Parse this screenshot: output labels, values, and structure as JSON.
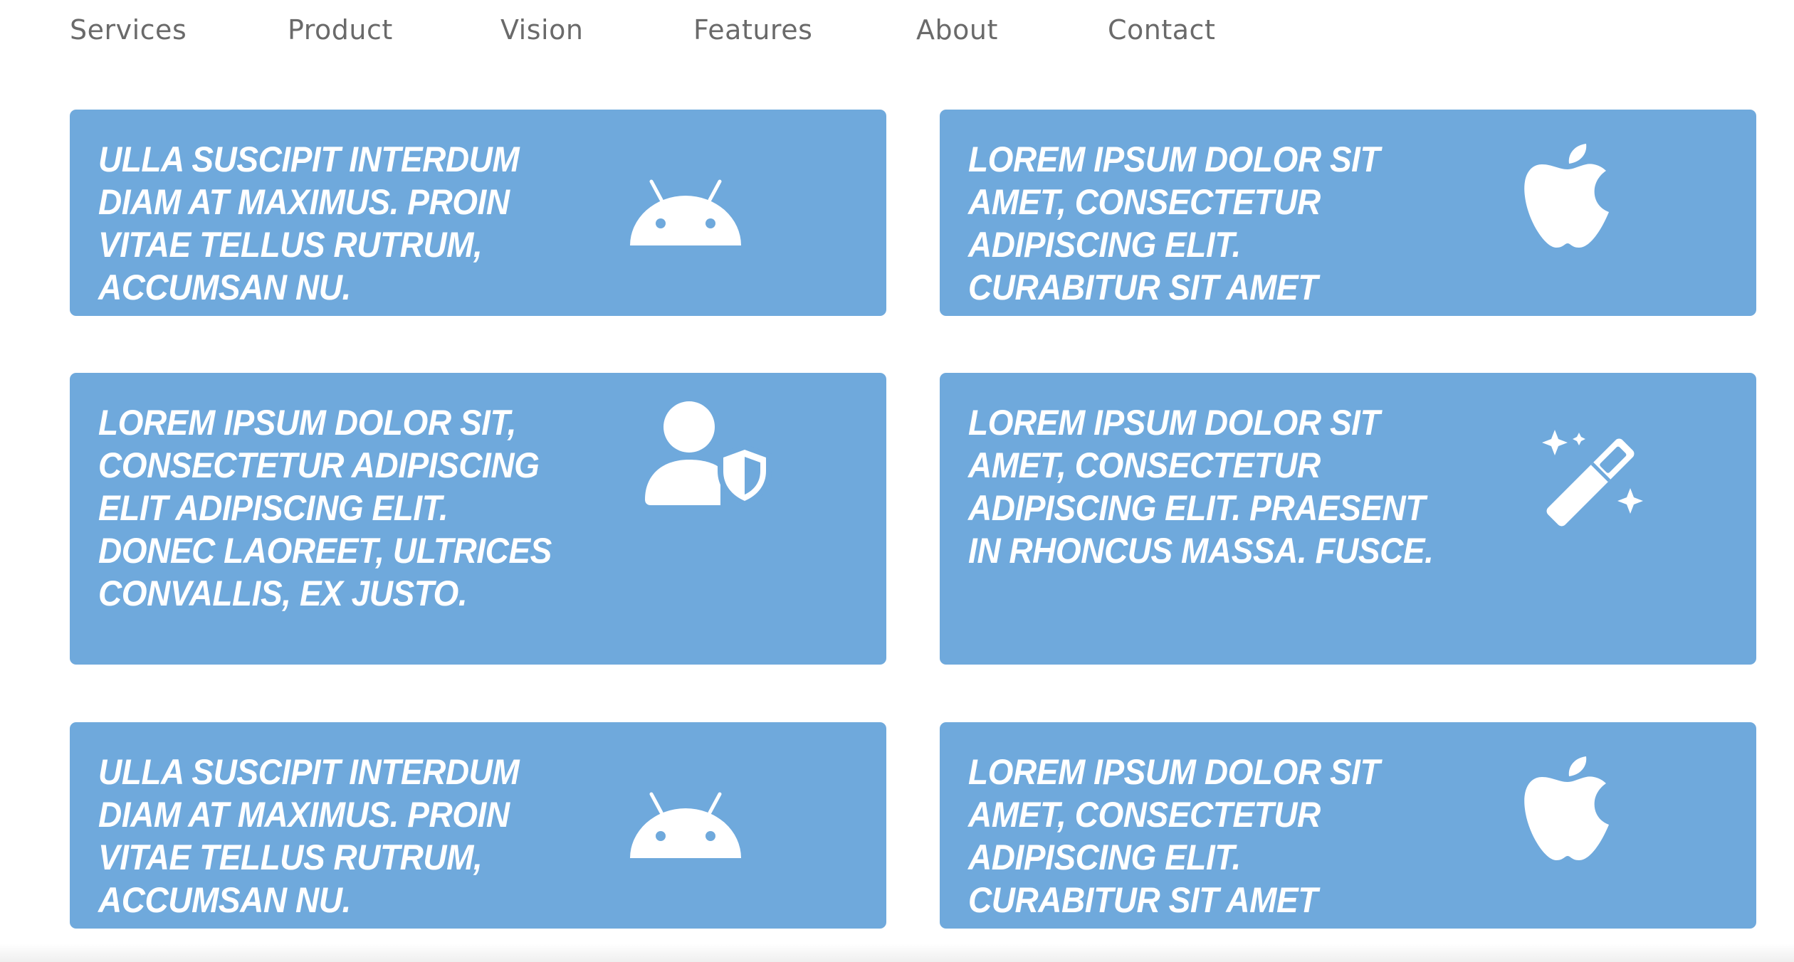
{
  "nav": {
    "items": [
      {
        "label": "Services"
      },
      {
        "label": "Product"
      },
      {
        "label": "Vision"
      },
      {
        "label": "Features"
      },
      {
        "label": "About"
      },
      {
        "label": "Contact"
      }
    ]
  },
  "cards": [
    {
      "text": "Ulla suscipit interdum diam at maximus. Proin vitae tellus rutrum, accumsan nu.",
      "icon": "android-icon"
    },
    {
      "text": "Lorem ipsum dolor sit amet, consectetur adipiscing elit. Curabitur sit amet neque.",
      "icon": "apple-icon"
    },
    {
      "text": "Lorem ipsum dolor sit, consectetur adipiscing elit adipiscing elit. Donec laoreet, ultrices convallis, ex justo.",
      "icon": "user-shield-icon"
    },
    {
      "text": "Lorem ipsum dolor sit amet, consectetur adipiscing elit. Praesent in rhoncus massa. Fusce.",
      "icon": "magic-wand-icon"
    },
    {
      "text": "Ulla suscipit interdum diam at maximus. Proin vitae tellus rutrum, accumsan nu.",
      "icon": "android-icon"
    },
    {
      "text": "Lorem ipsum dolor sit amet, consectetur adipiscing elit. Curabitur sit amet neque.",
      "icon": "apple-icon"
    }
  ],
  "colors": {
    "card_background": "#6fa9dc",
    "card_text": "#ffffff",
    "nav_text": "#6a6a6a"
  }
}
